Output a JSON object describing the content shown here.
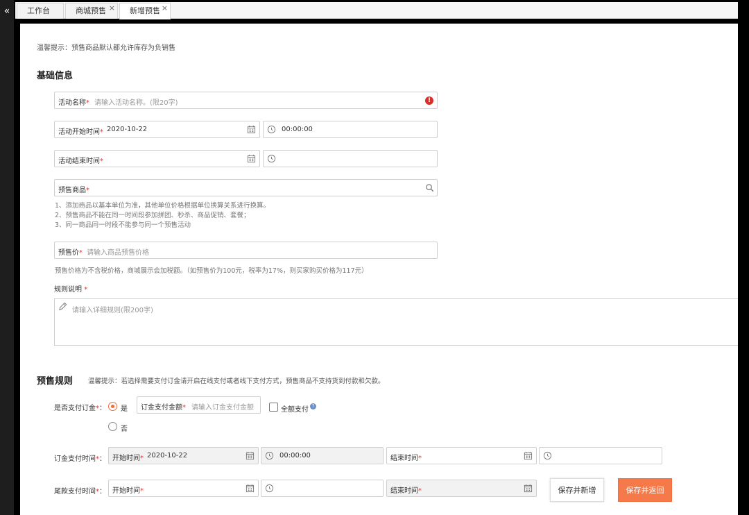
{
  "tabs": [
    {
      "label": "工作台",
      "closable": false
    },
    {
      "label": "商城预售",
      "closable": true
    },
    {
      "label": "新增预售",
      "closable": true,
      "active": true
    }
  ],
  "tip": "温馨提示：预售商品默认都允许库存为负销售",
  "basic": {
    "title": "基础信息",
    "activity_name": {
      "label": "活动名称",
      "placeholder": "请输入活动名称。(限20字)"
    },
    "start_time": {
      "label": "活动开始时间",
      "date": "2020-10-22",
      "time": "00:00:00"
    },
    "end_time": {
      "label": "活动结束时间",
      "date": "",
      "time": ""
    },
    "product": {
      "label": "预售商品"
    },
    "product_notes": [
      "1、添加商品以基本单位为准，其他单位价格根据单位换算关系进行换算。",
      "2、预售商品不能在同一时间段参加拼团、秒杀、商品促销、套餐；",
      "3、同一商品同一时段不能参与同一个预售活动"
    ],
    "presale_price": {
      "label": "预售价",
      "placeholder": "请输入商品预售价格"
    },
    "price_note": "预售价格为不含税价格，商城展示会加税额。（如预售价为100元，税率为17%，则买家购买价格为117元）",
    "rules": {
      "label": "规则说明",
      "placeholder": "请输入详细规则(限200字)"
    }
  },
  "presale_rules": {
    "title": "预售规则",
    "tip": "温馨提示：若选择需要支付订金请开启在线支付或者线下支付方式，预售商品不支持货到付款和欠款。",
    "deposit_question": "是否支付订金",
    "yes_label": "是",
    "no_label": "否",
    "deposit_amount": {
      "label": "订金支付金额",
      "placeholder": "请输入订金支付金额"
    },
    "full_payment_label": "全额支付",
    "deposit_time": {
      "label": "订金支付时间",
      "start_label": "开始时间",
      "start_date": "2020-10-22",
      "start_time": "00:00:00",
      "end_label": "结束时间"
    },
    "balance_time": {
      "label": "尾款支付时间",
      "start_label": "开始时间",
      "end_label": "结束时间"
    }
  },
  "buttons": {
    "save_new": "保存并新增",
    "save_return": "保存并返回"
  },
  "colors": {
    "accent": "#f26b3a",
    "required": "#e0332d",
    "error": "#d9302c"
  }
}
